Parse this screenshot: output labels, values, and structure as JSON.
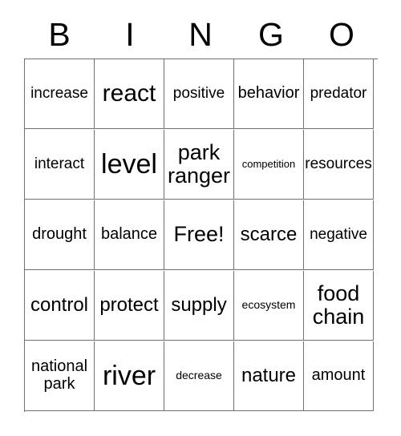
{
  "card": {
    "title": "BINGO",
    "header_letters": [
      "B",
      "I",
      "N",
      "G",
      "O"
    ],
    "free_space_label": "Free!",
    "colors": {
      "background": "#ffffff",
      "text": "#000000",
      "grid_line": "#6f6f6f"
    },
    "grid": {
      "columns": 5,
      "rows": 5,
      "cells": [
        [
          {
            "text": "increase",
            "size": "fs-m"
          },
          {
            "text": "react",
            "size": "fs-xxl"
          },
          {
            "text": "positive",
            "size": "fs-m"
          },
          {
            "text": "behavior",
            "size": "fs-ml"
          },
          {
            "text": "predator",
            "size": "fs-m"
          }
        ],
        [
          {
            "text": "interact",
            "size": "fs-m"
          },
          {
            "text": "level",
            "size": "fs-3xl"
          },
          {
            "text": "park ranger",
            "size": "fs-xl"
          },
          {
            "text": "competition",
            "size": "fs-xs"
          },
          {
            "text": "resources",
            "size": "fs-m"
          }
        ],
        [
          {
            "text": "drought",
            "size": "fs-ml"
          },
          {
            "text": "balance",
            "size": "fs-ml"
          },
          {
            "text": "Free!",
            "size": "fs-xl"
          },
          {
            "text": "scarce",
            "size": "fs-l"
          },
          {
            "text": "negative",
            "size": "fs-m"
          }
        ],
        [
          {
            "text": "control",
            "size": "fs-l"
          },
          {
            "text": "protect",
            "size": "fs-l"
          },
          {
            "text": "supply",
            "size": "fs-l"
          },
          {
            "text": "ecosystem",
            "size": "fs-s"
          },
          {
            "text": "food chain",
            "size": "fs-xl"
          }
        ],
        [
          {
            "text": "national park",
            "size": "fs-ml"
          },
          {
            "text": "river",
            "size": "fs-3xl"
          },
          {
            "text": "decrease",
            "size": "fs-s"
          },
          {
            "text": "nature",
            "size": "fs-l"
          },
          {
            "text": "amount",
            "size": "fs-ml"
          }
        ]
      ]
    }
  }
}
